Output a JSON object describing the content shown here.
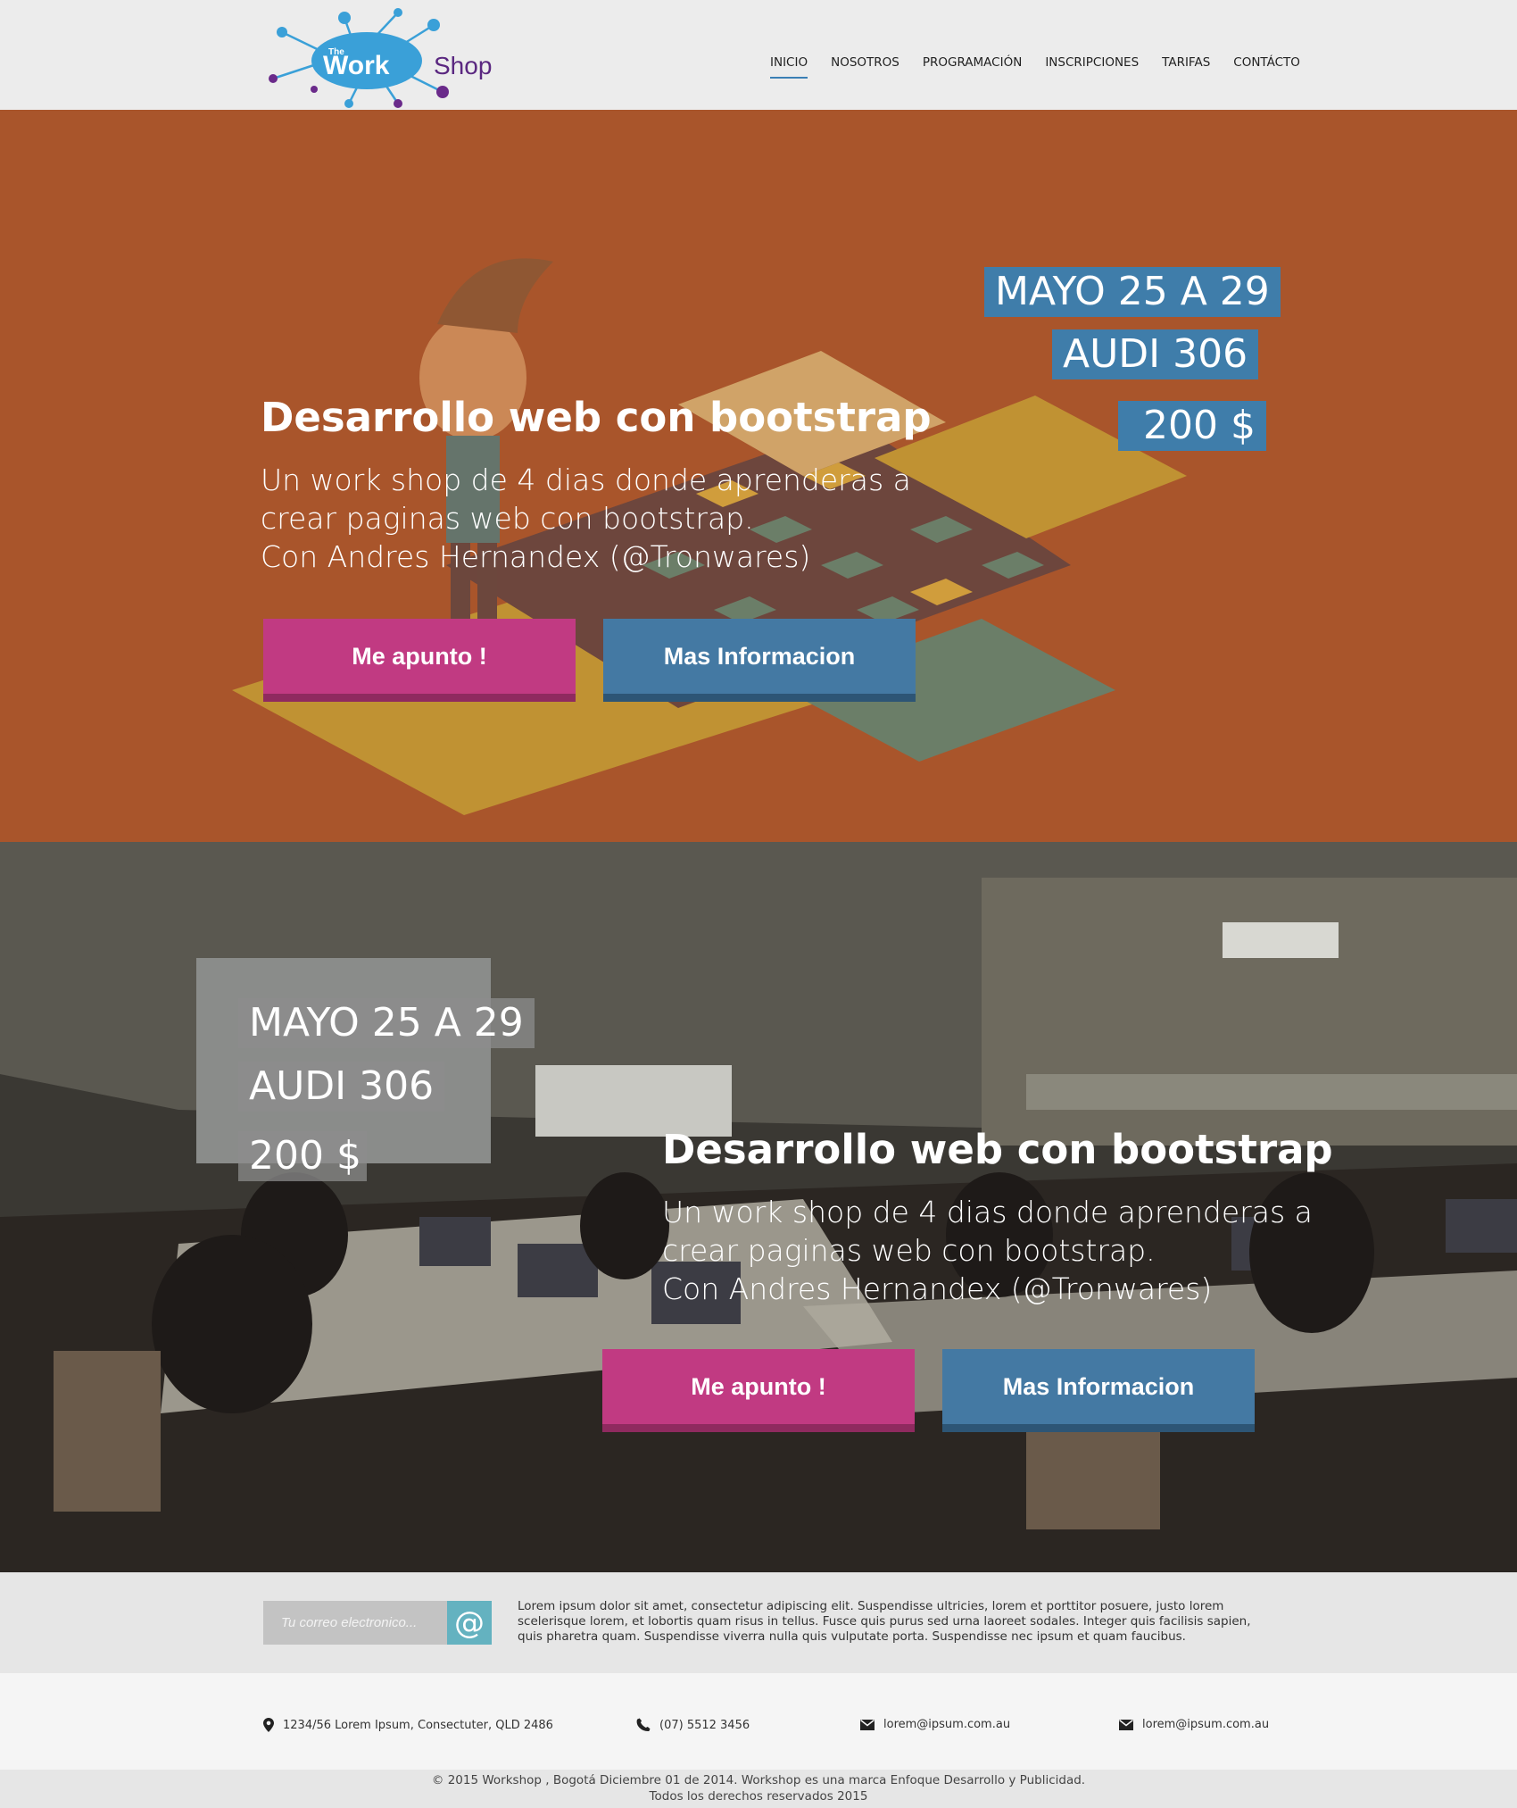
{
  "header": {
    "logo": {
      "the": "The",
      "work": "Work",
      "shop": "Shop"
    },
    "nav": [
      {
        "label": "INICIO",
        "active": true
      },
      {
        "label": "NOSOTROS"
      },
      {
        "label": "PROGRAMACIÓN"
      },
      {
        "label": "INSCRIPCIONES"
      },
      {
        "label": "TARIFAS"
      },
      {
        "label": "CONTÁCTO"
      }
    ]
  },
  "hero1": {
    "date": "MAYO 25 A 29",
    "room": "AUDI 306",
    "price": "200 $",
    "title": "Desarrollo web con bootstrap",
    "desc_lines": [
      "Un work shop de 4 dias donde aprenderas a",
      "crear paginas web con bootstrap.",
      "Con Andres Hernandex (@Tronwares)"
    ],
    "btn_primary": "Me apunto !",
    "btn_secondary": "Mas Informacion",
    "bg_color": "#a9552b"
  },
  "hero2": {
    "date": "MAYO 25 A 29",
    "room": "AUDI 306",
    "price": "200 $",
    "title": "Desarrollo web con bootstrap",
    "desc_lines": [
      "Un work shop de 4 dias donde aprenderas a",
      "crear paginas web con bootstrap.",
      "Con Andres Hernandex (@Tronwares)"
    ],
    "btn_primary": "Me apunto !",
    "btn_secondary": "Mas Informacion"
  },
  "newsletter": {
    "placeholder": "Tu correo electronico...",
    "button_icon": "@",
    "text": "Lorem ipsum dolor sit amet, consectetur adipiscing elit. Suspendisse ultricies, lorem et porttitor posuere, justo lorem scelerisque lorem, et lobortis quam risus in tellus. Fusce quis purus sed urna laoreet sodales. Integer quis facilisis sapien, quis pharetra quam. Suspendisse viverra nulla quis vulputate porta. Suspendisse nec ipsum et quam faucibus."
  },
  "contact": {
    "address": "1234/56 Lorem Ipsum, Consectuter, QLD 2486",
    "phone": "(07) 5512 3456",
    "email1": "lorem@ipsum.com.au",
    "email2": "lorem@ipsum.com.au",
    "icons": [
      "map-pin-icon",
      "phone-icon",
      "envelope-icon",
      "envelope-icon"
    ]
  },
  "footer": {
    "line1": "© 2015 Workshop , Bogotá Diciembre 01 de 2014. Workshop es una marca Enfoque Desarrollo y Publicidad.",
    "line2": "Todos los derechos reservados 2015"
  },
  "colors": {
    "accent_blue": "#3f7daa",
    "pink": "#c13a82",
    "teal": "#64b2c0"
  }
}
